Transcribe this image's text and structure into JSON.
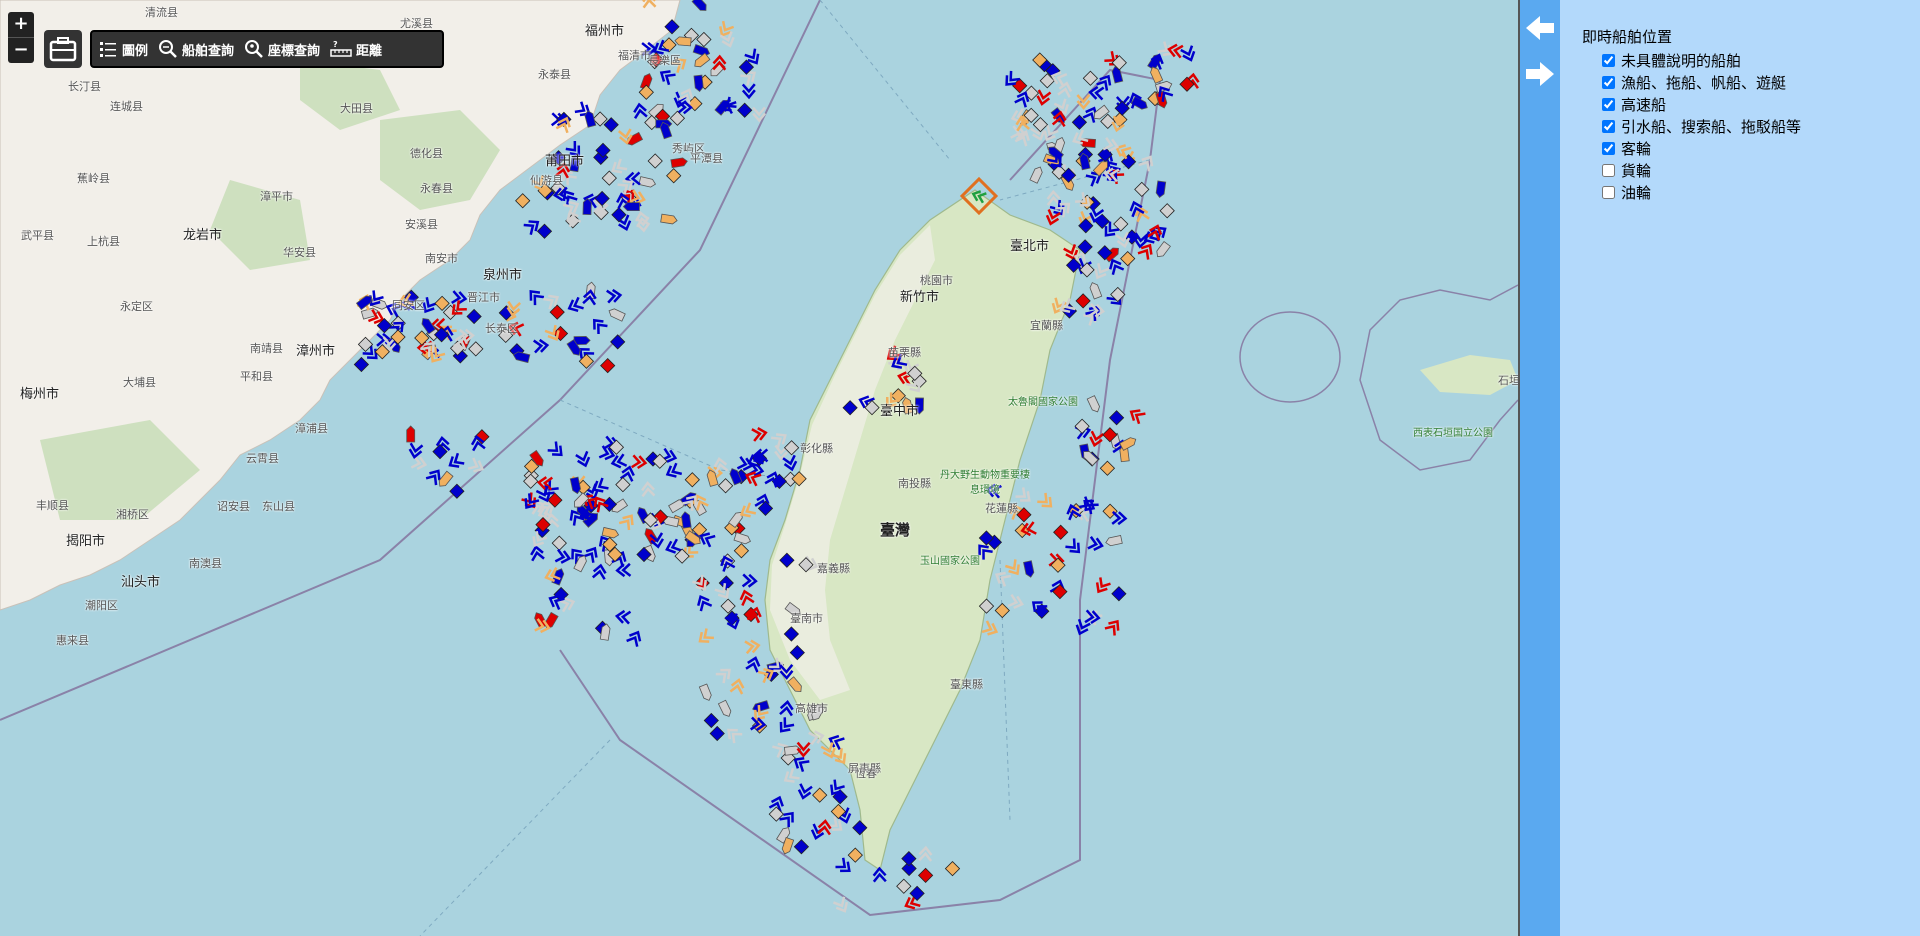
{
  "zoom": {
    "in_label": "+",
    "out_label": "−"
  },
  "toolbar": {
    "legend_label": "圖例",
    "ship_search_label": "船舶查詢",
    "coord_search_label": "座標查詢",
    "distance_label": "距離"
  },
  "panel": {
    "title": "即時船舶位置",
    "items": [
      {
        "label": "未具體說明的船舶",
        "checked": true
      },
      {
        "label": "漁船、拖船、帆船、遊艇",
        "checked": true
      },
      {
        "label": "高速船",
        "checked": true
      },
      {
        "label": "引水船、搜索船、拖駁船等",
        "checked": true
      },
      {
        "label": "客輪",
        "checked": true
      },
      {
        "label": "貨輪",
        "checked": false
      },
      {
        "label": "油輪",
        "checked": false
      }
    ]
  },
  "places": [
    "福州市",
    "長樂區",
    "清流县",
    "永泰县",
    "大田县",
    "莆田市",
    "仙游县",
    "德化县",
    "永春县",
    "泉州市",
    "南安市",
    "安溪县",
    "华安县",
    "龙岩市",
    "漳平市",
    "上杭县",
    "武平县",
    "永定区",
    "梅州市",
    "漳州市",
    "南靖县",
    "平和县",
    "同安区",
    "晋江市",
    "长泰区",
    "云霄县",
    "漳浦县",
    "揭阳市",
    "汕头市",
    "南澳县",
    "潮阳区",
    "惠来县",
    "丰顺县",
    "湘桥区",
    "诏安县",
    "东山县",
    "大埔县",
    "蕉岭县",
    "连城县",
    "长汀县",
    "尤溪县",
    "福清市",
    "秀屿区",
    "平潭县",
    "臺北市",
    "新竹市",
    "桃園市",
    "宜蘭縣",
    "苗栗縣",
    "臺中市",
    "彰化縣",
    "南投縣",
    "臺灣",
    "嘉義縣",
    "臺南市",
    "高雄市",
    "屏東縣",
    "臺東縣",
    "花蓮縣",
    "恆春",
    "太魯閣國家公園",
    "丹大野生動物重要棲息環境",
    "玉山國家公園",
    "西表石垣国立公園",
    "石垣市"
  ],
  "colors": {
    "sea": "#aad3df",
    "land": "#f2efe9",
    "forest": "#add19e",
    "vessel_blue": "#0000cc",
    "vessel_red": "#dd0000",
    "vessel_orange": "#f0b060",
    "vessel_gray": "#d0d0d0",
    "vessel_green": "#20a040",
    "panel_bg": "#b3d9fb",
    "panel_strip": "#5aa9f0"
  }
}
